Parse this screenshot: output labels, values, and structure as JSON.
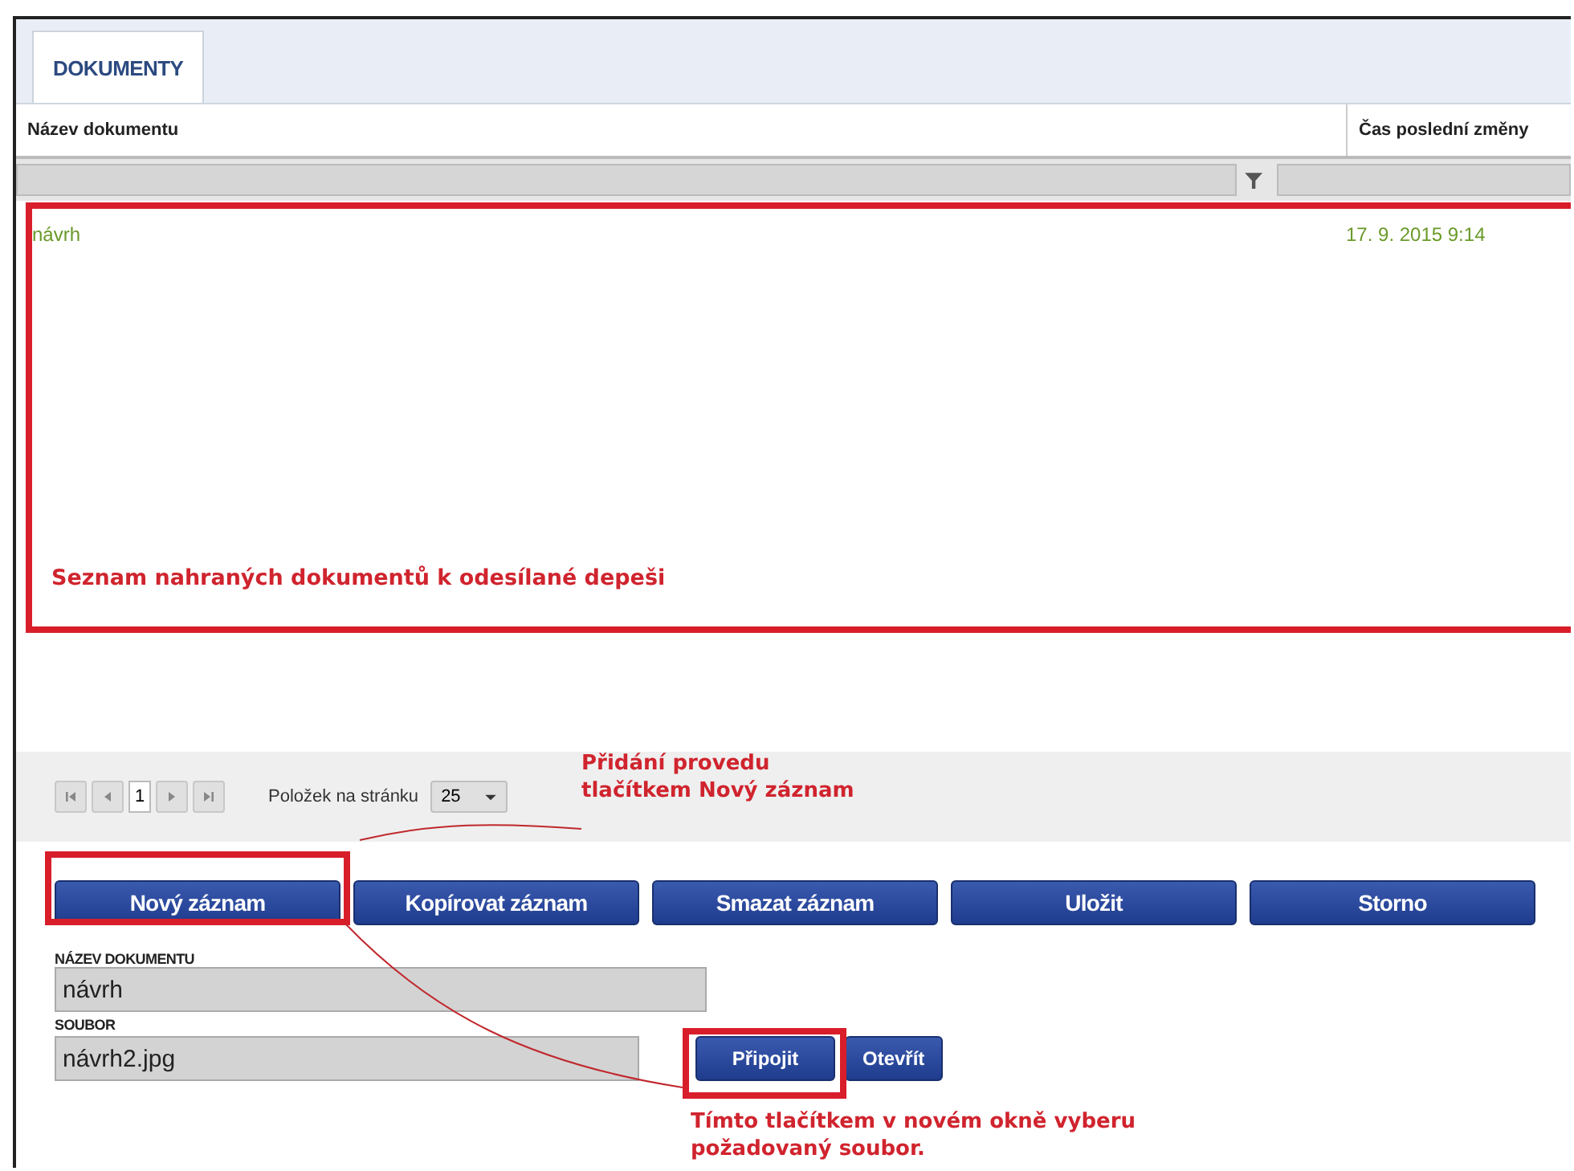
{
  "tab": {
    "label": "DOKUMENTY",
    "selected": true
  },
  "table": {
    "columns": [
      "Název dokumentu",
      "Čas poslední změny"
    ],
    "rows": [
      {
        "cells": [
          "návrh",
          "17. 9. 2015 9:14"
        ]
      }
    ]
  },
  "pager": {
    "page": "1",
    "page_size_label": "Položek na stránku",
    "page_size": "25"
  },
  "buttons": [
    "Nový záznam",
    "Kopírovat záznam",
    "Smazat záznam",
    "Uložit",
    "Storno"
  ],
  "form": {
    "fields": [
      {
        "label": "NÁZEV DOKUMENTU",
        "value": "návrh"
      },
      {
        "label": "SOUBOR",
        "value": "návrh2.jpg"
      }
    ],
    "file_buttons": [
      "Připojit",
      "Otevřít"
    ]
  },
  "annotations": [
    "Seznam nahraných dokumentů k odesílané depeši",
    "Přidání provedu\ntlačítkem Nový záznam",
    "Tímto tlačítkem v novém okně vyberu\npožadovaný soubor."
  ]
}
